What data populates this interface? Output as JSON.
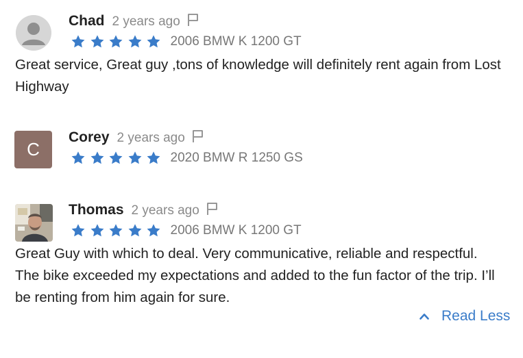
{
  "reviews": [
    {
      "name": "Chad",
      "time": "2 years ago",
      "rating": 5,
      "vehicle": "2006 BMW K 1200 GT",
      "text": "Great service, Great guy ,tons of knowledge will definitely rent again from Lost Highway",
      "avatar": "default-avatar-icon"
    },
    {
      "name": "Corey",
      "time": "2 years ago",
      "rating": 5,
      "vehicle": "2020 BMW R 1250 GS",
      "text": "",
      "avatar_letter": "C"
    },
    {
      "name": "Thomas",
      "time": "2 years ago",
      "rating": 5,
      "vehicle": "2006 BMW K 1200 GT",
      "text": "Great Guy with which to deal. Very communicative, reliable and respectful. The bike exceeded my expectations and added to the fun factor of the trip. I’ll be renting from him again for sure.",
      "avatar": "photo-avatar"
    }
  ],
  "read_less_label": "Read Less",
  "colors": {
    "star": "#3a7cc9",
    "link": "#3a7cc9",
    "avatar_letter_bg": "#8c6f67"
  }
}
